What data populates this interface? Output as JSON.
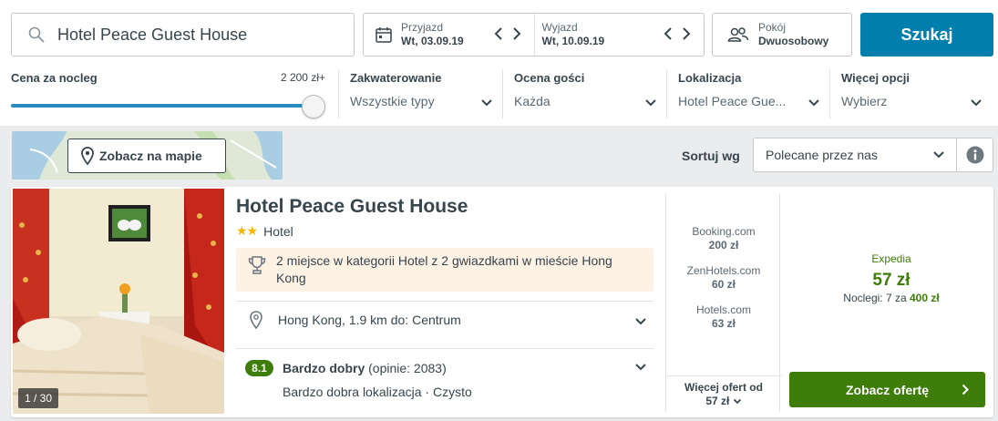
{
  "search": {
    "value": "Hotel Peace Guest House",
    "icon": "search-icon"
  },
  "dates": {
    "checkin_label": "Przyjazd",
    "checkin_value": "Wt, 03.09.19",
    "checkout_label": "Wyjazd",
    "checkout_value": "Wt, 10.09.19"
  },
  "room": {
    "label": "Pokój",
    "value": "Dwuosobowy"
  },
  "search_button": "Szukaj",
  "filters": {
    "price": {
      "label": "Cena za nocleg",
      "max": "2 200 zł+",
      "level": 1.0
    },
    "accommodation": {
      "label": "Zakwaterowanie",
      "value": "Wszystkie typy"
    },
    "guest_rating": {
      "label": "Ocena gości",
      "value": "Każda"
    },
    "location": {
      "label": "Lokalizacja",
      "value": "Hotel Peace Gue..."
    },
    "more": {
      "label": "Więcej opcji",
      "value": "Wybierz"
    }
  },
  "map_button": "Zobacz na mapie",
  "sort": {
    "label": "Sortuj wg",
    "value": "Polecane przez nas"
  },
  "hotel": {
    "name": "Hotel Peace Guest House",
    "stars": "★★",
    "type": "Hotel",
    "award": "2 miejsce w kategorii Hotel z 2 gwiazdkami w mieście Hong Kong",
    "location": "Hong Kong, 1.9 km do: Centrum",
    "rating_score": "8.1",
    "rating_label": "Bardzo dobry",
    "rating_count": "(opinie: 2083)",
    "rating_sub": "Bardzo dobra lokalizacja · Czysto",
    "photo_count": "1 / 30"
  },
  "deals": [
    {
      "provider": "Booking.com",
      "price": "200 zł"
    },
    {
      "provider": "ZenHotels.com",
      "price": "60 zł"
    },
    {
      "provider": "Hotels.com",
      "price": "63 zł"
    }
  ],
  "more_offers": {
    "line1": "Więcej ofert od",
    "line2": "57 zł"
  },
  "best_deal": {
    "provider": "Expedia",
    "price": "57 zł",
    "nights_prefix": "Noclegi: 7 za",
    "nights_total": "400 zł",
    "button": "Zobacz ofertę"
  },
  "colors": {
    "primary_blue": "#007fad",
    "deal_green": "#3e7d0a",
    "star_yellow": "#f4b400",
    "award_bg": "#fdf2e3"
  }
}
